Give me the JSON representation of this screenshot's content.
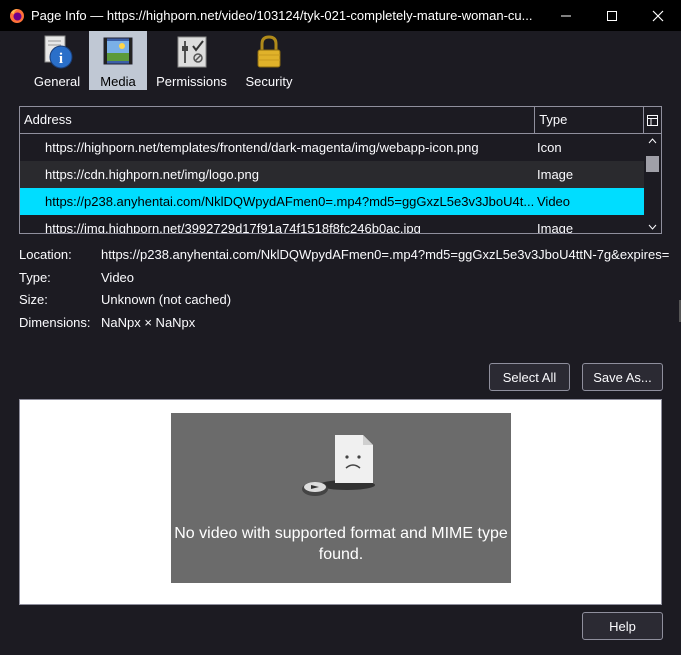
{
  "window": {
    "title": "Page Info — https://highporn.net/video/103124/tyk-021-completely-mature-woman-cu..."
  },
  "tabs": [
    {
      "id": "general",
      "label": "General",
      "icon": "info-icon"
    },
    {
      "id": "media",
      "label": "Media",
      "icon": "media-icon",
      "selected": true
    },
    {
      "id": "permissions",
      "label": "Permissions",
      "icon": "permissions-icon"
    },
    {
      "id": "security",
      "label": "Security",
      "icon": "padlock-icon"
    }
  ],
  "media_table": {
    "columns": {
      "address": "Address",
      "type": "Type"
    },
    "rows": [
      {
        "address": "https://highporn.net/templates/frontend/dark-magenta/img/webapp-icon.png",
        "type": "Icon"
      },
      {
        "address": "https://cdn.highporn.net/img/logo.png",
        "type": "Image"
      },
      {
        "address": "https://p238.anyhentai.com/NklDQWpydAFmen0=.mp4?md5=ggGxzL5e3v3JboU4t...",
        "type": "Video",
        "selected": true
      },
      {
        "address": "https://img.highporn.net/3992729d17f91a74f1518f8fc246b0ac.jpg",
        "type": "Image"
      }
    ]
  },
  "details": {
    "location_label": "Location:",
    "location_value": "https://p238.anyhentai.com/NklDQWpydAFmen0=.mp4?md5=ggGxzL5e3v3JboU4ttN-7g&expires=",
    "type_label": "Type:",
    "type_value": "Video",
    "size_label": "Size:",
    "size_value": "Unknown (not cached)",
    "dimensions_label": "Dimensions:",
    "dimensions_value": "NaNpx × NaNpx"
  },
  "buttons": {
    "select_all": "Select All",
    "save_as": "Save As...",
    "help": "Help"
  },
  "preview": {
    "error_message": "No video with supported format and MIME type found."
  },
  "colors": {
    "background": "#1c1b22",
    "selection": "#00ddff",
    "preview_bg": "#6b6b6b"
  }
}
